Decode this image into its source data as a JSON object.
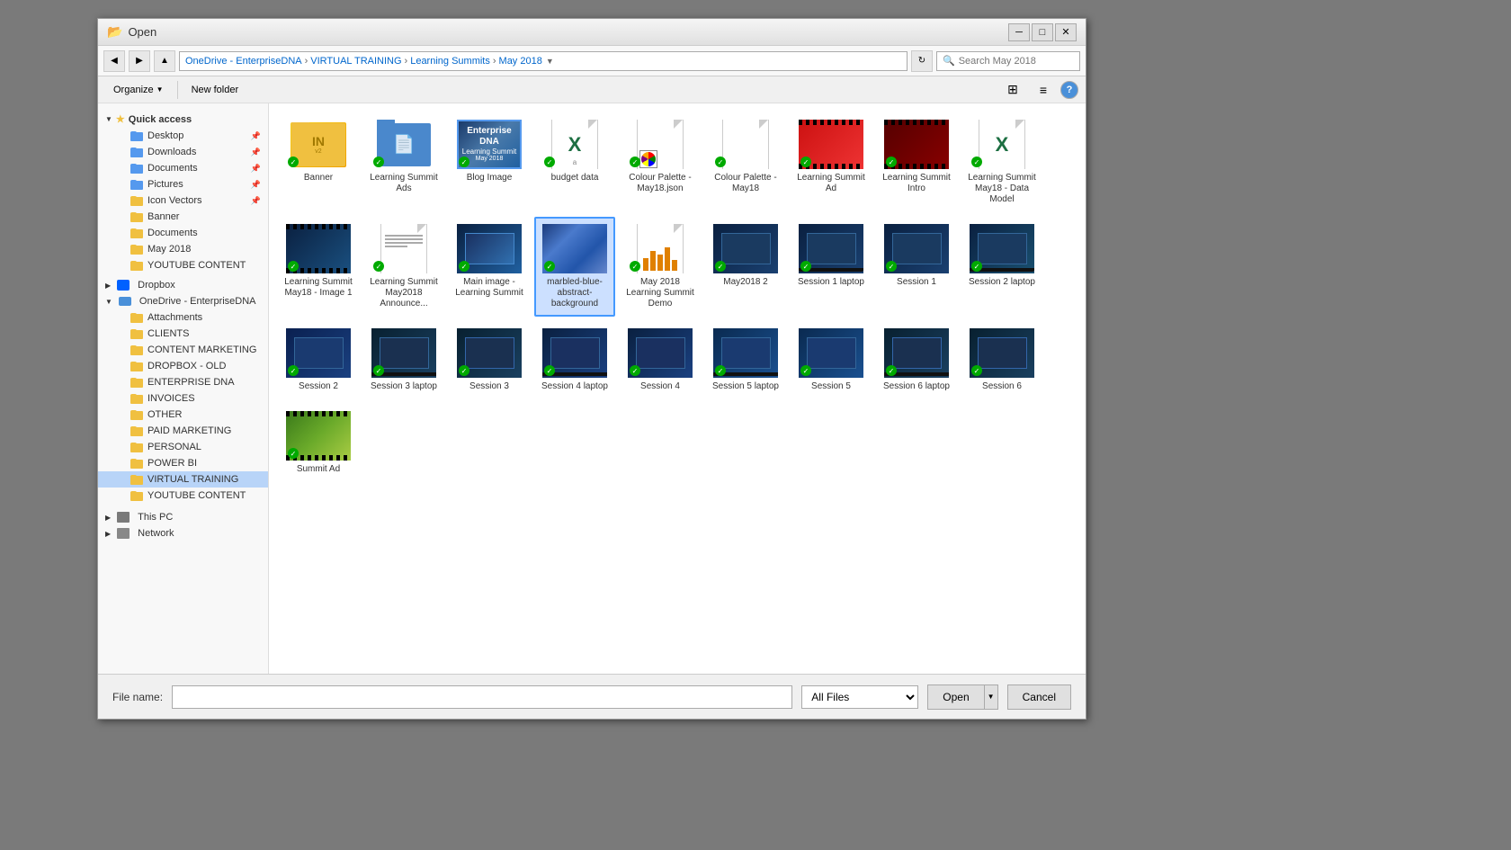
{
  "window": {
    "title": "Open",
    "title_icon": "📁"
  },
  "address": {
    "path": "OneDrive - EnterpriseDNA » VIRTUAL TRAINING » Learning Summits » May 2018",
    "segments": [
      "OneDrive - EnterpriseDNA",
      "VIRTUAL TRAINING",
      "Learning Summits",
      "May 2018"
    ],
    "search_placeholder": "Search May 2018"
  },
  "toolbar": {
    "organize_label": "Organize",
    "new_folder_label": "New folder"
  },
  "sidebar": {
    "quick_access": "Quick access",
    "items_quick": [
      {
        "label": "Desktop",
        "pinned": true
      },
      {
        "label": "Downloads",
        "pinned": true
      },
      {
        "label": "Documents",
        "pinned": true
      },
      {
        "label": "Pictures",
        "pinned": true
      },
      {
        "label": "Icon Vectors",
        "pinned": true
      },
      {
        "label": "Banner"
      },
      {
        "label": "Documents"
      },
      {
        "label": "May 2018"
      },
      {
        "label": "YOUTUBE CONTENT"
      }
    ],
    "dropbox_label": "Dropbox",
    "onedrive_label": "OneDrive - EnterpriseDNA",
    "onedrive_items": [
      {
        "label": "Attachments"
      },
      {
        "label": "CLIENTS"
      },
      {
        "label": "CONTENT MARKETING"
      },
      {
        "label": "DROPBOX - OLD"
      },
      {
        "label": "ENTERPRISE DNA"
      },
      {
        "label": "INVOICES"
      },
      {
        "label": "OTHER"
      },
      {
        "label": "PAID MARKETING"
      },
      {
        "label": "PERSONAL"
      },
      {
        "label": "POWER BI"
      },
      {
        "label": "VIRTUAL TRAINING",
        "selected": true
      },
      {
        "label": "YOUTUBE CONTENT"
      }
    ],
    "this_pc_label": "This PC",
    "network_label": "Network"
  },
  "files": [
    {
      "name": "Banner",
      "type": "folder_yellow"
    },
    {
      "name": "Learning Summit Ads",
      "type": "folder_blue"
    },
    {
      "name": "Blog Image",
      "type": "image_blue"
    },
    {
      "name": "budget data",
      "type": "excel"
    },
    {
      "name": "Colour Palette - May18.json",
      "type": "json"
    },
    {
      "name": "Colour Palette - May18",
      "type": "doc"
    },
    {
      "name": "Learning Summit Ad",
      "type": "video_red"
    },
    {
      "name": "Learning Summit Intro",
      "type": "video_red2"
    },
    {
      "name": "Learning Summit May18 - Data Model",
      "type": "excel2"
    },
    {
      "name": "Learning Summit May18 - Image 1",
      "type": "image_dark"
    },
    {
      "name": "Learning Summit May2018 Announce...",
      "type": "doc2"
    },
    {
      "name": "Main image - Learning Summit",
      "type": "screen_dark"
    },
    {
      "name": "marbled-blue-abstract-background",
      "type": "blue_abstract",
      "selected": true
    },
    {
      "name": "May 2018 Learning Summit Demo",
      "type": "chart_yellow"
    },
    {
      "name": "May2018 2",
      "type": "screen2"
    },
    {
      "name": "Session 1 laptop",
      "type": "screen3"
    },
    {
      "name": "Session 1",
      "type": "screen4"
    },
    {
      "name": "Session 2 laptop",
      "type": "screen5"
    },
    {
      "name": "Session 2",
      "type": "screen6"
    },
    {
      "name": "Session 3 laptop",
      "type": "screen7"
    },
    {
      "name": "Session 3",
      "type": "screen8"
    },
    {
      "name": "Session 4 laptop",
      "type": "screen9"
    },
    {
      "name": "Session 4",
      "type": "screen10"
    },
    {
      "name": "Session 5 laptop",
      "type": "screen11"
    },
    {
      "name": "Session 5",
      "type": "screen12"
    },
    {
      "name": "Session 6 laptop",
      "type": "screen13"
    },
    {
      "name": "Session 6",
      "type": "screen14"
    },
    {
      "name": "Summit Ad",
      "type": "video_green"
    }
  ],
  "bottom": {
    "filename_label": "File name:",
    "filename_value": "",
    "filetype_value": "All Files",
    "open_label": "Open",
    "cancel_label": "Cancel"
  }
}
